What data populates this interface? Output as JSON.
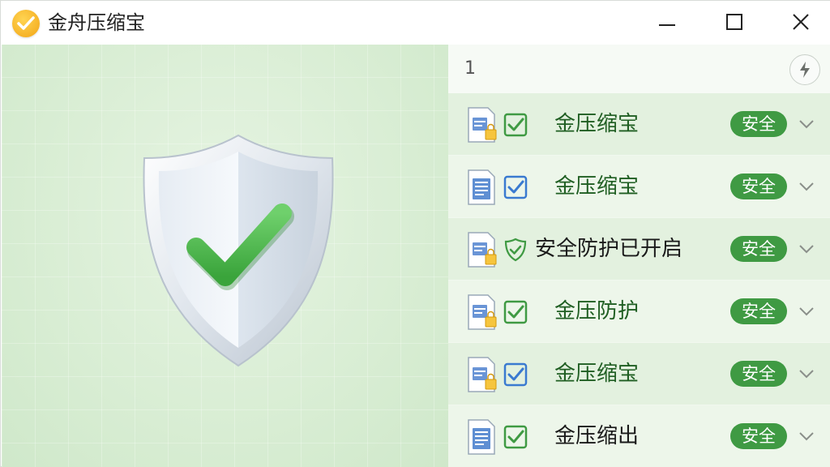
{
  "window": {
    "title": "金舟压缩宝"
  },
  "panel": {
    "count": "1"
  },
  "items": [
    {
      "label": "金压缩宝",
      "status": "安全",
      "file_icon": "locked-document-icon",
      "check_icon": "checkbox-checked-icon"
    },
    {
      "label": "金压缩宝",
      "status": "安全",
      "file_icon": "document-icon",
      "check_icon": "checkbox-checked-icon"
    },
    {
      "label": "安全防护已开启",
      "status": "安全",
      "file_icon": "locked-document-icon",
      "check_icon": "shield-check-icon"
    },
    {
      "label": "金压防护",
      "status": "安全",
      "file_icon": "locked-document-icon",
      "check_icon": "checkbox-checked-icon"
    },
    {
      "label": "金压缩宝",
      "status": "安全",
      "file_icon": "locked-document-icon",
      "check_icon": "checkbox-checked-icon"
    },
    {
      "label": "金压缩出",
      "status": "安全",
      "file_icon": "document-icon",
      "check_icon": "checkbox-checked-icon"
    }
  ],
  "colors": {
    "accent": "#3f9a43",
    "panel_bg": "#dcefd8",
    "logo": "#f2a516"
  }
}
